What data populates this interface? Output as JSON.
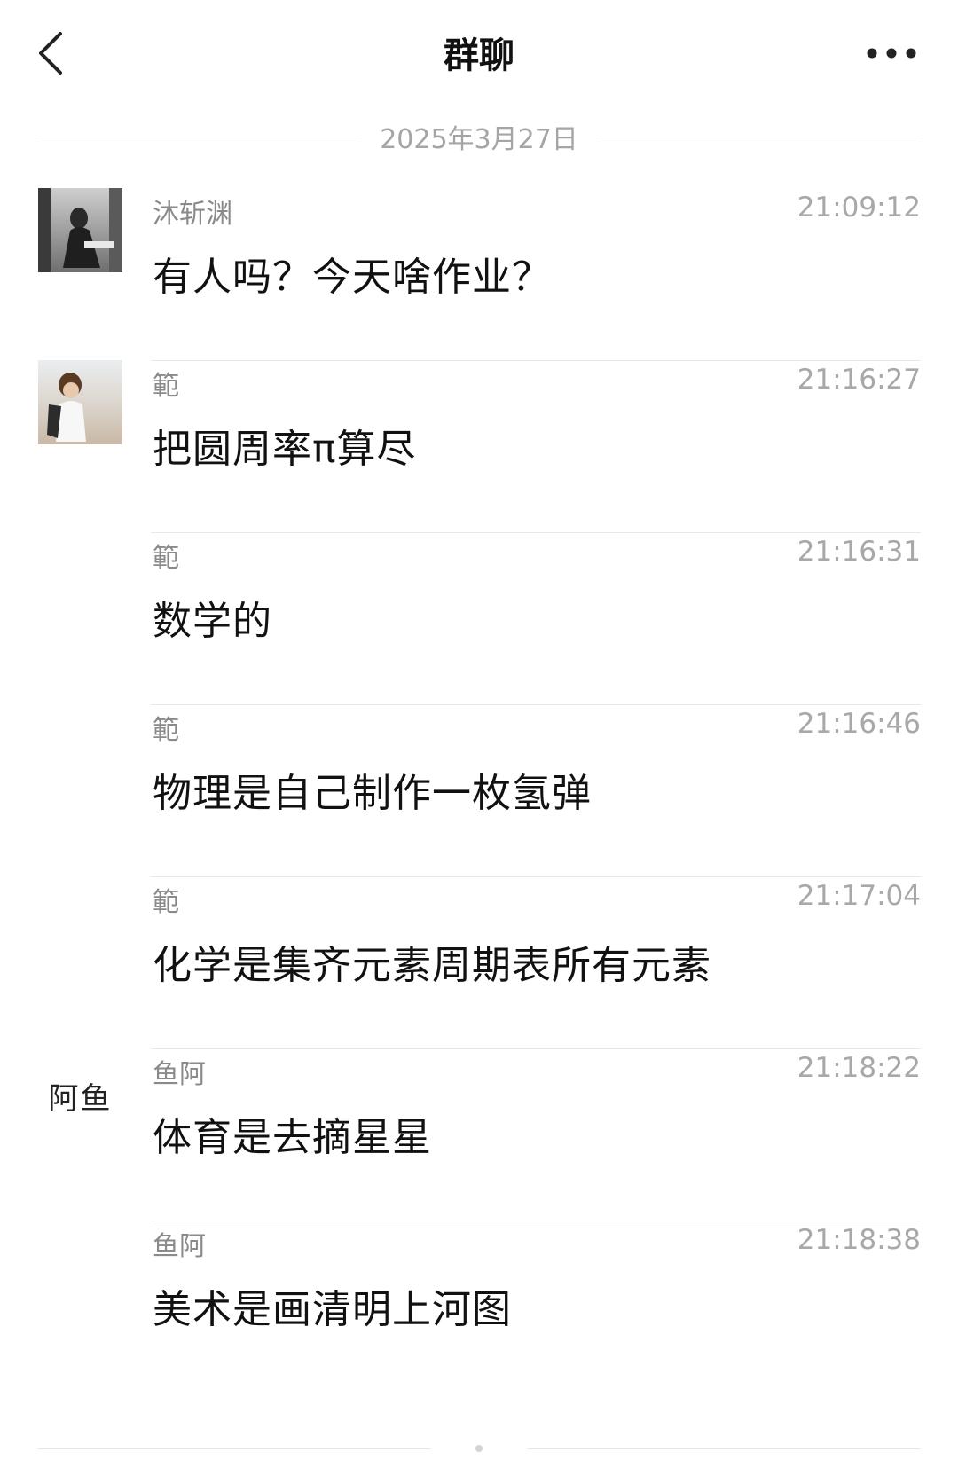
{
  "header": {
    "title": "群聊",
    "back_icon": "chevron-left-icon",
    "more_icon": "ellipsis-icon"
  },
  "date_divider": "2025年3月27日",
  "messages": [
    {
      "sender": "沐斩渊",
      "time": "21:09:12",
      "text": "有人吗？今天啥作业？"
    },
    {
      "sender": "範",
      "time": "21:16:27",
      "text": "把圆周率π算尽"
    },
    {
      "sender": "範",
      "time": "21:16:31",
      "text": "数学的"
    },
    {
      "sender": "範",
      "time": "21:16:46",
      "text": "物理是自己制作一枚氢弹"
    },
    {
      "sender": "範",
      "time": "21:17:04",
      "text": "化学是集齐元素周期表所有元素"
    },
    {
      "sender": "鱼阿",
      "time": "21:18:22",
      "text": "体育是去摘星星",
      "avatar_text": "阿鱼"
    },
    {
      "sender": "鱼阿",
      "time": "21:18:38",
      "text": "美术是画清明上河图"
    }
  ],
  "colors": {
    "background": "#ffffff",
    "text_primary": "#111111",
    "text_secondary": "#8a8a8a",
    "divider": "#e8e8e8"
  }
}
